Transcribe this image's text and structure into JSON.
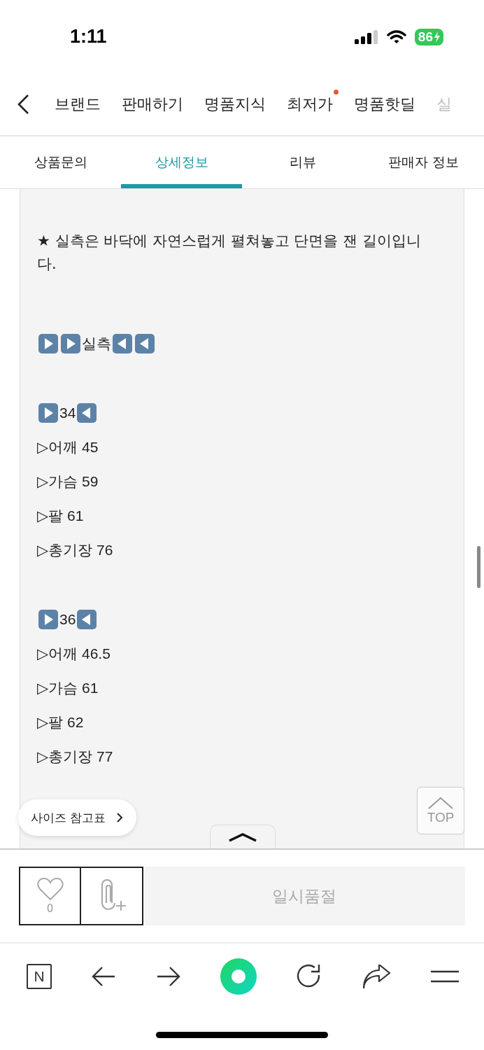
{
  "status_bar": {
    "time": "1:11",
    "battery": "86"
  },
  "nav": {
    "items": [
      {
        "label": "브랜드",
        "dot": false,
        "faded": false
      },
      {
        "label": "판매하기",
        "dot": false,
        "faded": false
      },
      {
        "label": "명품지식",
        "dot": false,
        "faded": false
      },
      {
        "label": "최저가",
        "dot": true,
        "faded": false
      },
      {
        "label": "명품핫딜",
        "dot": false,
        "faded": false
      },
      {
        "label": "실",
        "dot": false,
        "faded": true
      }
    ]
  },
  "tabs": [
    {
      "label": "상품문의",
      "selected": false
    },
    {
      "label": "상세정보",
      "selected": true
    },
    {
      "label": "리뷰",
      "selected": false
    },
    {
      "label": "판매자 정보",
      "selected": false
    }
  ],
  "detail": {
    "note": "★ 실측은 바닥에 자연스럽게 펼쳐놓고 단면을 잰 길이입니다.",
    "heading": "실측",
    "sizes": [
      {
        "size": "34",
        "items": [
          "▷어깨 45",
          "▷가슴 59",
          "▷팔 61",
          "▷총기장 76"
        ]
      },
      {
        "size": "36",
        "items": [
          "▷어깨 46.5",
          "▷가슴 61",
          "▷팔 62",
          "▷총기장 77"
        ]
      }
    ]
  },
  "size_chart_button": "사이즈 참고표",
  "top_button": "TOP",
  "like_count": "0",
  "soldout_button": "일시품절",
  "browser_logo": "N"
}
